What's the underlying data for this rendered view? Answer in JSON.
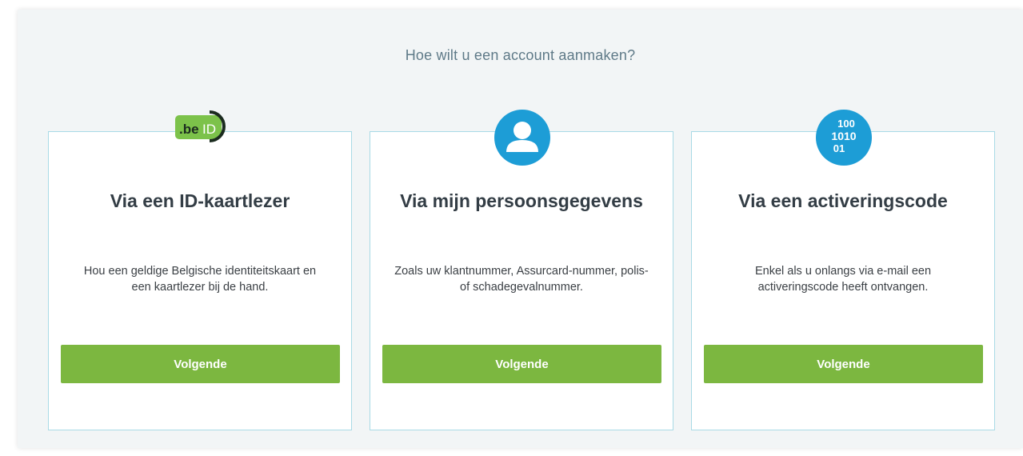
{
  "page": {
    "heading": "Hoe wilt u een account aanmaken?"
  },
  "cards": [
    {
      "icon": "beid-logo",
      "icon_text_be": ".be",
      "icon_text_id": "ID",
      "title": "Via een ID-kaartlezer",
      "description": "Hou een geldige Belgische identiteitskaart en een kaartlezer bij de hand.",
      "button": "Volgende"
    },
    {
      "icon": "person-icon",
      "title": "Via mijn persoonsgegevens",
      "description": "Zoals uw klantnummer, Assurcard-nummer, polis- of schadegevalnummer.",
      "button": "Volgende"
    },
    {
      "icon": "binary-code-icon",
      "icon_text_lines": [
        "100",
        "1010",
        "01"
      ],
      "title": "Via een activeringscode",
      "description": "Enkel als u onlangs via e-mail een activeringscode heeft ontvangen.",
      "button": "Volgende"
    }
  ],
  "colors": {
    "accent_button": "#7cb740",
    "icon_blue": "#1d9dd6",
    "beid_green": "#7cc24a",
    "card_border": "#a9dae6",
    "panel_bg": "#f2f5f6"
  }
}
